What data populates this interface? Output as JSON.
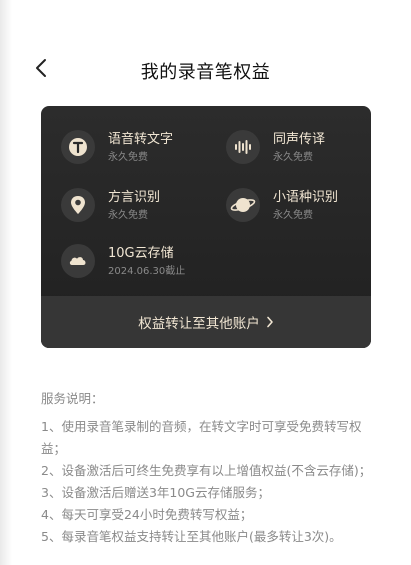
{
  "header": {
    "title": "我的录音笔权益"
  },
  "benefits": [
    {
      "name": "语音转文字",
      "sub": "永久免费",
      "icon": "text-t-icon"
    },
    {
      "name": "同声传译",
      "sub": "永久免费",
      "icon": "waveform-icon"
    },
    {
      "name": "方言识别",
      "sub": "永久免费",
      "icon": "location-pin-icon"
    },
    {
      "name": "小语种识别",
      "sub": "永久免费",
      "icon": "planet-icon"
    },
    {
      "name": "10G云存储",
      "sub": "2024.06.30截止",
      "icon": "cloud-icon"
    }
  ],
  "transfer": {
    "label": "权益转让至其他账户"
  },
  "service": {
    "heading": "服务说明：",
    "items": [
      "1、使用录音笔录制的音频，在转文字时可享受免费转写权益；",
      "2、设备激活后可终生免费享有以上增值权益(不含云存储)；",
      "3、设备激活后赠送3年10G云存储服务；",
      "4、每天可享受24小时免费转写权益；",
      "5、每录音笔权益支持转让至其他账户(最多转让3次)。"
    ]
  },
  "colors": {
    "card_bg": "#262626",
    "gold_text": "#f1e6d3",
    "muted_text": "#8a8a8a"
  }
}
